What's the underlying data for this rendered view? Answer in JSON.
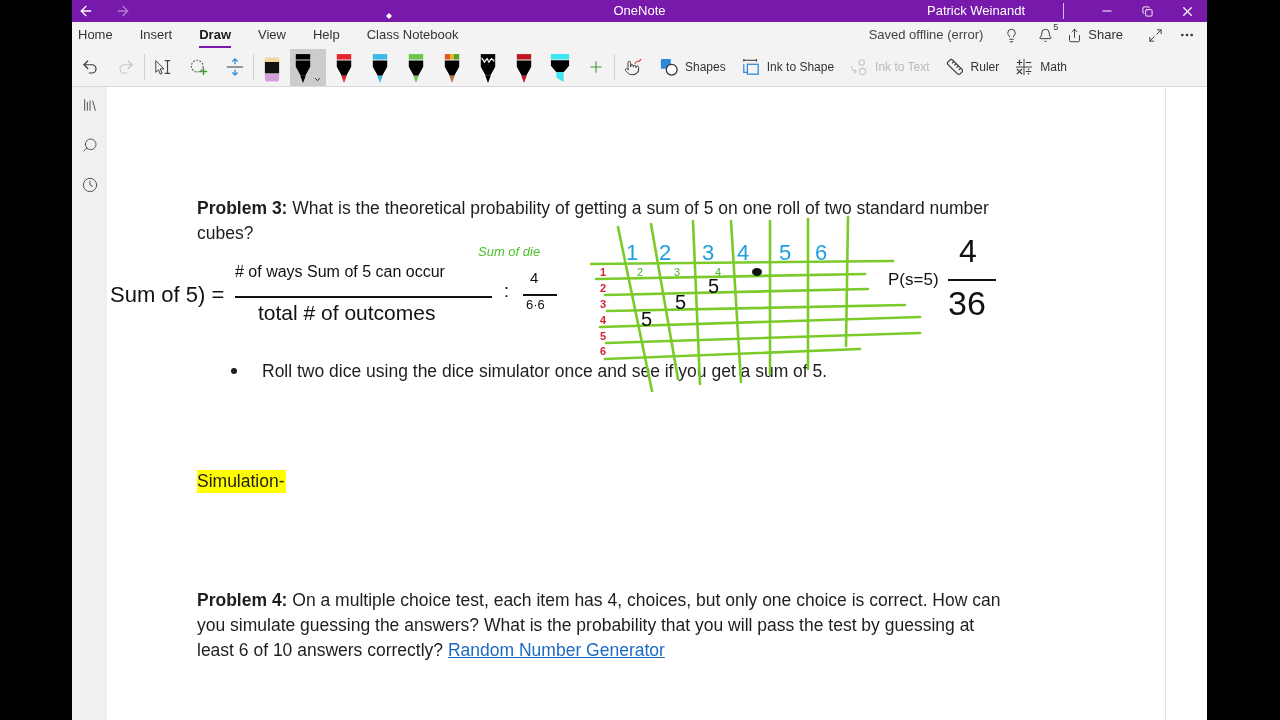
{
  "window": {
    "title": "OneNote",
    "user": "Patrick Weinandt",
    "nav": [
      {
        "kind": "back",
        "disabled": false
      },
      {
        "kind": "forward",
        "disabled": true
      }
    ]
  },
  "ribbon_tabs": [
    {
      "label": "Home",
      "selected": false
    },
    {
      "label": "Insert",
      "selected": false
    },
    {
      "label": "Draw",
      "selected": true
    },
    {
      "label": "View",
      "selected": false
    },
    {
      "label": "Help",
      "selected": false
    },
    {
      "label": "Class Notebook",
      "selected": false
    }
  ],
  "ribbon_status": {
    "save_state": "Saved offline (error)",
    "notification_count": "5",
    "share_label": "Share"
  },
  "toolbar": {
    "history": [
      {
        "kind": "undo",
        "disabled": false
      },
      {
        "kind": "redo",
        "disabled": true
      }
    ],
    "pens": [
      {
        "kind": "eraser",
        "selected": false
      },
      {
        "kind": "pen",
        "color": "#000000",
        "selected": true
      },
      {
        "kind": "pen",
        "color": "#e3242b",
        "selected": false
      },
      {
        "kind": "pen",
        "color": "#3bb8e8",
        "selected": false
      },
      {
        "kind": "pen",
        "color": "#6cc644",
        "selected": false
      },
      {
        "kind": "galaxy_pen",
        "selected": false
      },
      {
        "kind": "textured_pen",
        "color": "#000000",
        "selected": false
      },
      {
        "kind": "pen",
        "color": "#c0161e",
        "selected": false
      },
      {
        "kind": "highlighter",
        "color": "#3ee6f0",
        "selected": false
      }
    ],
    "commands": [
      {
        "kind": "shapes",
        "label": "Shapes",
        "disabled": false
      },
      {
        "kind": "ink_to_shape",
        "label": "Ink to Shape",
        "disabled": false
      },
      {
        "kind": "ink_to_text",
        "label": "Ink to Text",
        "disabled": true
      },
      {
        "kind": "ruler",
        "label": "Ruler",
        "disabled": false
      },
      {
        "kind": "math",
        "label": "Math",
        "disabled": false
      }
    ]
  },
  "page": {
    "blocks": [
      {
        "kind": "problem",
        "text": "**Problem 3:** What is the theoretical probability of getting a sum of 5 on one roll of two standard number cubes?"
      },
      {
        "kind": "bullet",
        "text": "Roll two dice using the dice simulator once and see if you get a sum of 5."
      },
      {
        "kind": "highlight",
        "text": "Simulation-"
      },
      {
        "kind": "problem",
        "text": "**Problem 4:** On a multiple choice test, each item has 4, choices, but only one choice is correct. How can you simulate guessing the answers? What is the probability that you will pass the test by guessing at least 6 of 10 answers correctly?",
        "link": "Random Number Generator"
      }
    ],
    "ink": {
      "note": "Sum of die",
      "formula": {
        "left_side": "Sum of 5) =",
        "numerator": "# of ways Sum of 5 can occur",
        "denominator": "total # of outcomes",
        "operator": ":",
        "result_numerator": "4",
        "result_denominator": "6·6"
      },
      "dice_table": {
        "column_headers": [
          "1",
          "2",
          "3",
          "4",
          "5",
          "6"
        ],
        "row_headers": [
          "1",
          "2",
          "3",
          "4",
          "5",
          "6"
        ],
        "first_row_sums": [
          "2",
          "3",
          "4"
        ],
        "sum_of_five_cells": [
          "5",
          "5",
          "5"
        ]
      },
      "probability": {
        "label": "P(s=5)",
        "numerator": "4",
        "denominator": "36"
      }
    }
  }
}
